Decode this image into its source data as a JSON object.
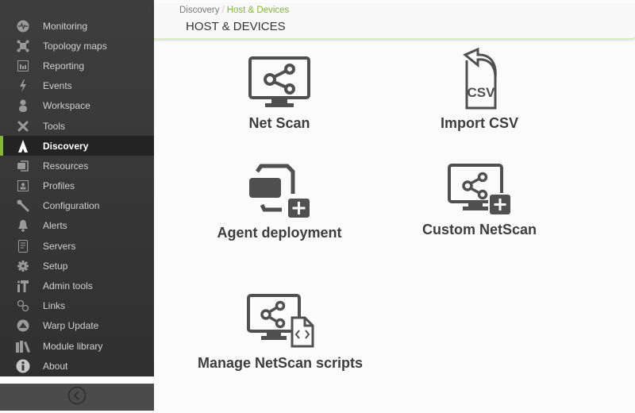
{
  "sidebar": {
    "items": [
      {
        "label": "Monitoring",
        "icon": "monitoring-icon"
      },
      {
        "label": "Topology maps",
        "icon": "topology-icon"
      },
      {
        "label": "Reporting",
        "icon": "reporting-icon"
      },
      {
        "label": "Events",
        "icon": "events-icon"
      },
      {
        "label": "Workspace",
        "icon": "workspace-icon"
      },
      {
        "label": "Tools",
        "icon": "tools-icon"
      },
      {
        "label": "Discovery",
        "icon": "discovery-icon",
        "active": true
      },
      {
        "label": "Resources",
        "icon": "resources-icon"
      },
      {
        "label": "Profiles",
        "icon": "profiles-icon"
      },
      {
        "label": "Configuration",
        "icon": "configuration-icon"
      },
      {
        "label": "Alerts",
        "icon": "alerts-icon"
      },
      {
        "label": "Servers",
        "icon": "servers-icon"
      },
      {
        "label": "Setup",
        "icon": "setup-icon"
      },
      {
        "label": "Admin tools",
        "icon": "admin-tools-icon"
      },
      {
        "label": "Links",
        "icon": "links-icon"
      },
      {
        "label": "Warp Update",
        "icon": "warp-update-icon"
      },
      {
        "label": "Module library",
        "icon": "module-library-icon"
      },
      {
        "label": "About",
        "icon": "about-icon"
      }
    ],
    "collapse_icon": "chevron-left-circle-icon"
  },
  "header": {
    "breadcrumb": {
      "parent": "Discovery",
      "separator": "/",
      "current": "Host & Devices"
    },
    "title": "HOST & DEVICES"
  },
  "tiles": [
    {
      "label": "Net Scan",
      "icon": "net-scan-icon"
    },
    {
      "label": "Import CSV",
      "icon": "import-csv-icon",
      "icon_text": "CSV"
    },
    {
      "label": "Agent deployment",
      "icon": "agent-deployment-icon"
    },
    {
      "label": "Custom NetScan",
      "icon": "custom-netscan-icon"
    },
    {
      "label": "Manage NetScan scripts",
      "icon": "manage-netscan-scripts-icon"
    }
  ],
  "colors": {
    "accent": "#82b92e",
    "sidebar_bg": "#363636",
    "icon": "#505050"
  }
}
